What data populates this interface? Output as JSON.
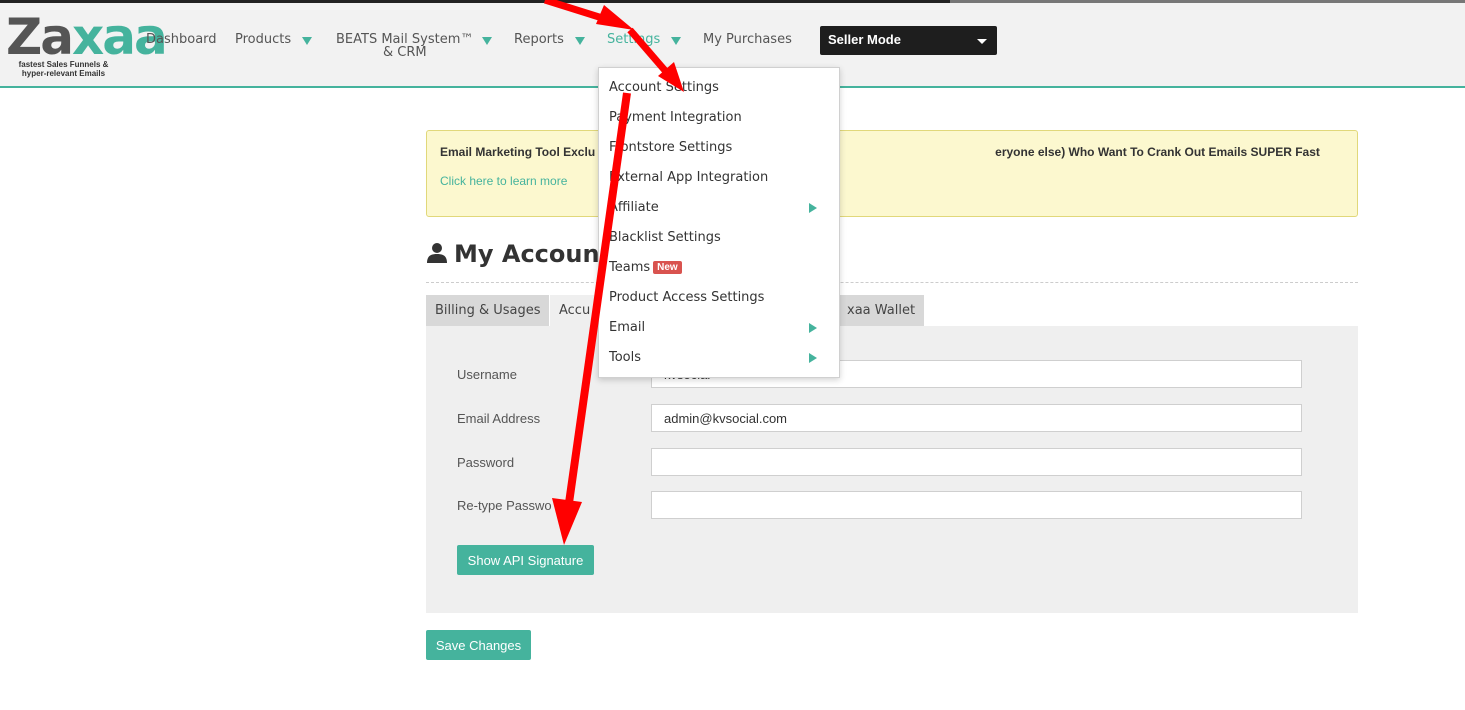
{
  "app": {
    "logo_brand_a": "Za",
    "logo_brand_b": "xaa",
    "logo_tagline_line1": "fastest Sales Funnels &",
    "logo_tagline_line2": "hyper-relevant Emails"
  },
  "nav": {
    "dashboard": "Dashboard",
    "products": "Products",
    "beats_line1": "BEATS Mail System™",
    "beats_line2": "& CRM",
    "reports": "Reports",
    "settings": "Settings",
    "my_purchases": "My Purchases",
    "mode_select": "Seller Mode"
  },
  "alert": {
    "headline": "Email Marketing Tool Exclu",
    "headline_tail": "eryone else) Who Want To Crank Out Emails SUPER Fast",
    "link": "Click here to learn more"
  },
  "page": {
    "title": "My Accoun"
  },
  "tabs": {
    "billing": "Billing & Usages",
    "account": "Accu",
    "wallet": "xaa Wallet"
  },
  "form": {
    "username_label": "Username",
    "username_value": "kvsocial",
    "email_label": "Email Address",
    "email_value": "admin@kvsocial.com",
    "password_label": "Password",
    "password_value": "",
    "retype_label": "Re-type Passwo",
    "retype_value": "",
    "api_button": "Show API Signature",
    "save_button": "Save Changes"
  },
  "settings_menu": {
    "items": [
      {
        "label": "Account Settings"
      },
      {
        "label": "Payment Integration"
      },
      {
        "label": "Frontstore Settings"
      },
      {
        "label": "External App Integration"
      },
      {
        "label": "Affiliate"
      },
      {
        "label": "Blacklist Settings"
      },
      {
        "label": "Teams"
      },
      {
        "label": "Product Access Settings"
      },
      {
        "label": "Email"
      },
      {
        "label": "Tools"
      }
    ],
    "teams_badge": "New"
  },
  "colors": {
    "accent": "#45b39d",
    "arrow": "#ff0000",
    "alert_bg": "#fcf8cf",
    "badge": "#d9534f"
  }
}
